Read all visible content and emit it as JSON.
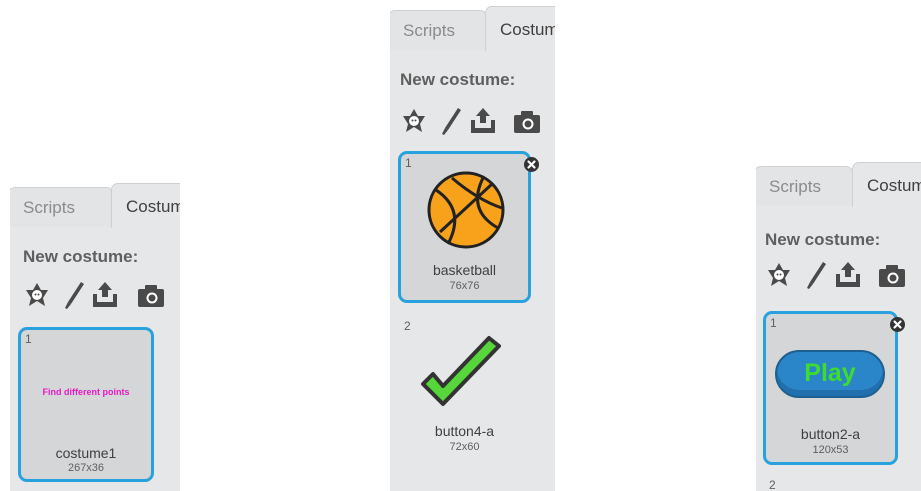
{
  "colors": {
    "selection_border": "#29a1dc",
    "panel_bg": "#e6e7e8",
    "play_text": "#3ddc2e",
    "check_green": "#56d63a"
  },
  "panels": [
    {
      "tabs": {
        "scripts": "Scripts",
        "costumes": "Costumes"
      },
      "heading": "New costume:",
      "tools": [
        "paint-from-library-icon",
        "paint-brush-icon",
        "upload-icon",
        "camera-icon"
      ],
      "costumes": [
        {
          "number": "1",
          "name": "costume1",
          "size": "267x36",
          "preview_text": "Find different points",
          "selected": true
        }
      ]
    },
    {
      "tabs": {
        "scripts": "Scripts",
        "costumes": "Costumes"
      },
      "heading": "New costume:",
      "tools": [
        "paint-from-library-icon",
        "paint-brush-icon",
        "upload-icon",
        "camera-icon"
      ],
      "costumes": [
        {
          "number": "1",
          "name": "basketball",
          "size": "76x76",
          "preview": "basketball-icon",
          "selected": true
        },
        {
          "number": "2",
          "name": "button4-a",
          "size": "72x60",
          "preview": "checkmark-icon",
          "selected": false
        }
      ]
    },
    {
      "tabs": {
        "scripts": "Scripts",
        "costumes": "Costumes"
      },
      "heading": "New costume:",
      "tools": [
        "paint-from-library-icon",
        "paint-brush-icon",
        "upload-icon",
        "camera-icon"
      ],
      "costumes": [
        {
          "number": "1",
          "name": "button2-a",
          "size": "120x53",
          "preview_text": "Play",
          "selected": true
        },
        {
          "number": "2",
          "selected": false
        }
      ]
    }
  ]
}
